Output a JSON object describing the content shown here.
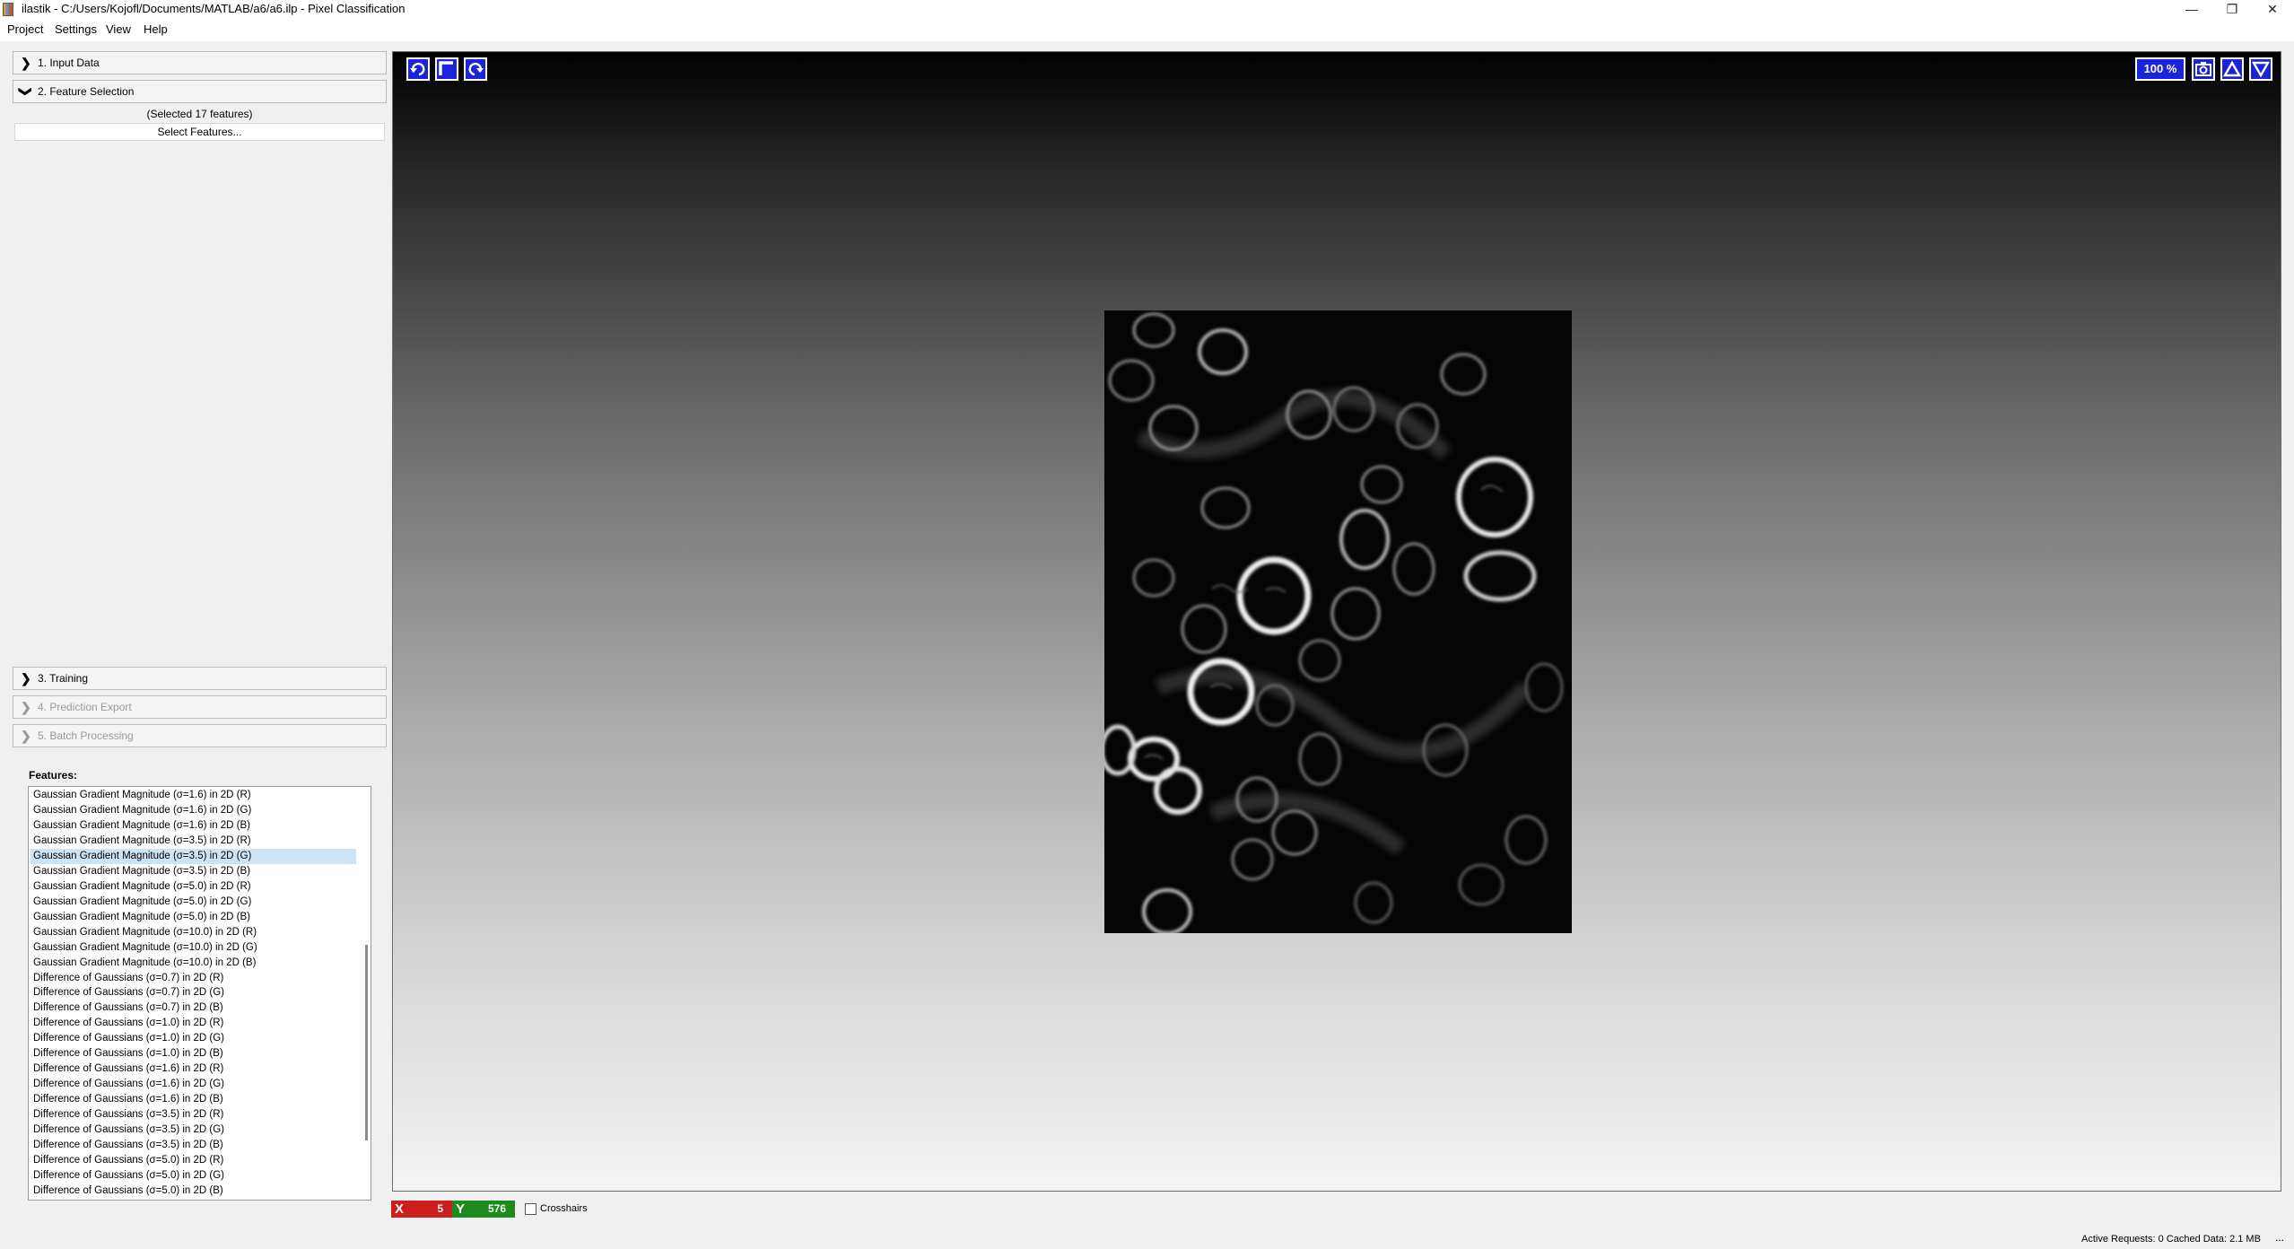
{
  "window": {
    "title": "ilastik - C:/Users/Kojofl/Documents/MATLAB/a6/a6.ilp - Pixel Classification",
    "minimize": "—",
    "restore": "❐",
    "close": "✕"
  },
  "menu": [
    "Project",
    "Settings",
    "View",
    "Help"
  ],
  "applets": [
    {
      "label": "1. Input Data",
      "chevron": "❯",
      "enabled": true
    },
    {
      "label": "2. Feature Selection",
      "chevron": "❯",
      "enabled": true,
      "expanded": true
    },
    {
      "label": "3. Training",
      "chevron": "❯",
      "enabled": true
    },
    {
      "label": "4. Prediction Export",
      "chevron": "❯",
      "enabled": false
    },
    {
      "label": "5. Batch Processing",
      "chevron": "❯",
      "enabled": false
    }
  ],
  "feature_selection": {
    "selected_count": "(Selected 17 features)",
    "select_button": "Select Features..."
  },
  "features": {
    "label": "Features:",
    "selected_index": 4,
    "items": [
      "Gaussian Gradient Magnitude (σ=1.6) in 2D (R)",
      "Gaussian Gradient Magnitude (σ=1.6) in 2D (G)",
      "Gaussian Gradient Magnitude (σ=1.6) in 2D (B)",
      "Gaussian Gradient Magnitude (σ=3.5) in 2D (R)",
      "Gaussian Gradient Magnitude (σ=3.5) in 2D (G)",
      "Gaussian Gradient Magnitude (σ=3.5) in 2D (B)",
      "Gaussian Gradient Magnitude (σ=5.0) in 2D (R)",
      "Gaussian Gradient Magnitude (σ=5.0) in 2D (G)",
      "Gaussian Gradient Magnitude (σ=5.0) in 2D (B)",
      "Gaussian Gradient Magnitude (σ=10.0) in 2D (R)",
      "Gaussian Gradient Magnitude (σ=10.0) in 2D (G)",
      "Gaussian Gradient Magnitude (σ=10.0) in 2D (B)",
      "Difference of Gaussians (σ=0.7) in 2D (R)",
      "Difference of Gaussians (σ=0.7) in 2D (G)",
      "Difference of Gaussians (σ=0.7) in 2D (B)",
      "Difference of Gaussians (σ=1.0) in 2D (R)",
      "Difference of Gaussians (σ=1.0) in 2D (G)",
      "Difference of Gaussians (σ=1.0) in 2D (B)",
      "Difference of Gaussians (σ=1.6) in 2D (R)",
      "Difference of Gaussians (σ=1.6) in 2D (G)",
      "Difference of Gaussians (σ=1.6) in 2D (B)",
      "Difference of Gaussians (σ=3.5) in 2D (R)",
      "Difference of Gaussians (σ=3.5) in 2D (G)",
      "Difference of Gaussians (σ=3.5) in 2D (B)",
      "Difference of Gaussians (σ=5.0) in 2D (R)",
      "Difference of Gaussians (σ=5.0) in 2D (G)",
      "Difference of Gaussians (σ=5.0) in 2D (B)"
    ]
  },
  "viewer": {
    "zoom": "100 %",
    "toolbar_icons": [
      "undo-icon",
      "fit-icon",
      "redo-icon"
    ],
    "right_icons": [
      "camera-icon",
      "triangle-up-icon",
      "triangle-down-icon"
    ]
  },
  "status": {
    "x_label": "X",
    "x_value": "5",
    "y_label": "Y",
    "y_value": "576",
    "crosshairs": "Crosshairs",
    "right_text": "Active Requests: 0  Cached Data: 2.1 MB",
    "dots": "..."
  },
  "colors": {
    "tool_blue": "#1a24d8",
    "x_red": "#cc1e1e",
    "y_green": "#1c8a1c",
    "list_highlight": "#cde4f7"
  }
}
